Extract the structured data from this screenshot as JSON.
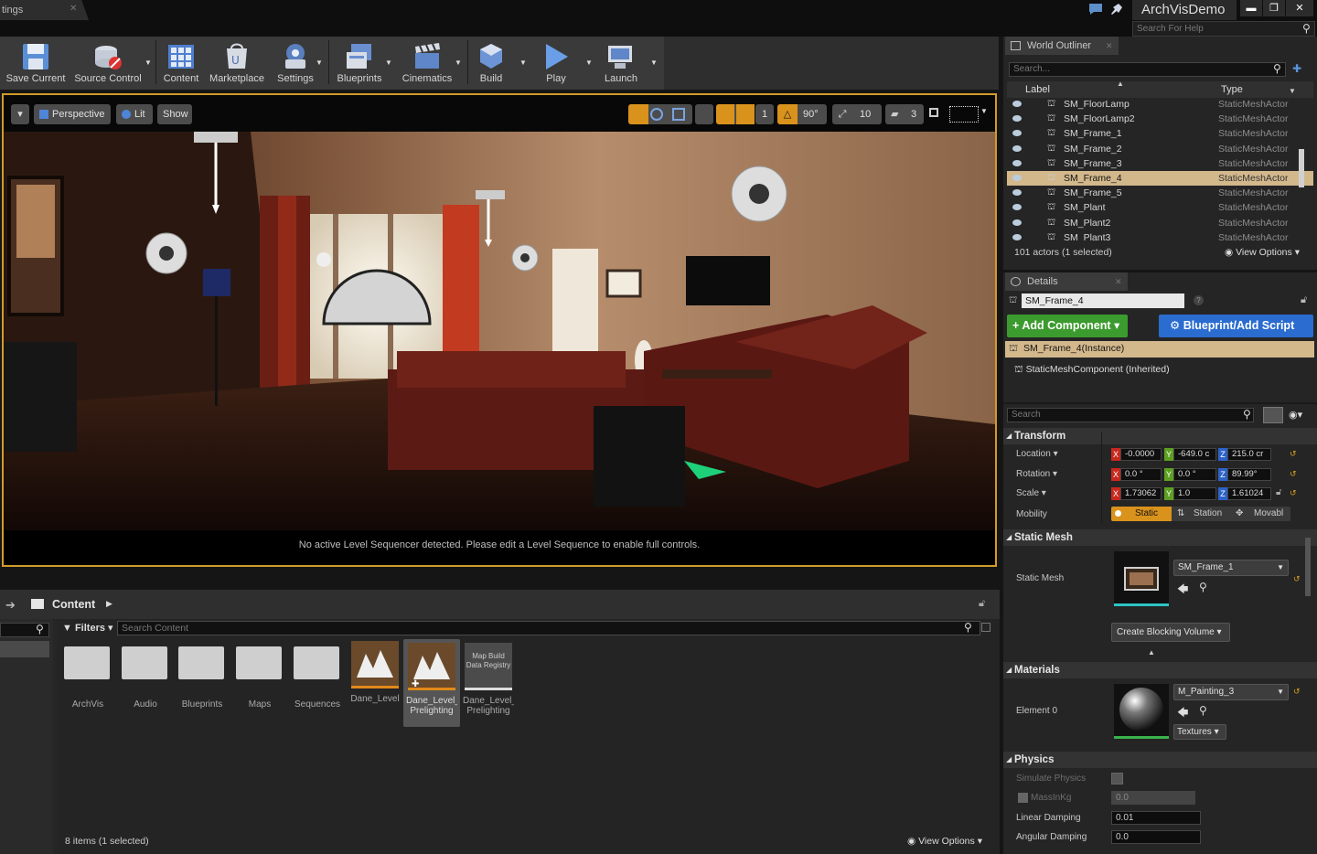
{
  "titlebar": {
    "tab_label": "tings",
    "project_name": "ArchVisDemo",
    "help_search_placeholder": "Search For Help"
  },
  "toolbar": {
    "buttons": [
      {
        "label": "Save Current"
      },
      {
        "label": "Source Control"
      },
      {
        "label": "Content"
      },
      {
        "label": "Marketplace"
      },
      {
        "label": "Settings"
      },
      {
        "label": "Blueprints"
      },
      {
        "label": "Cinematics"
      },
      {
        "label": "Build"
      },
      {
        "label": "Play"
      },
      {
        "label": "Launch"
      }
    ]
  },
  "viewport": {
    "view_mode": "Perspective",
    "lighting": "Lit",
    "show": "Show",
    "rotation_snap": "90°",
    "scale_snap": "10",
    "grid_snap": "1",
    "camera_speed": "3",
    "message": "No active Level Sequencer detected. Please edit a Level Sequence to enable full controls."
  },
  "content_browser": {
    "breadcrumb": "Content",
    "filters_label": "Filters",
    "search_placeholder": "Search Content",
    "status": "8 items (1 selected)",
    "view_options": "View Options",
    "assets": [
      {
        "label": "ArchVis",
        "kind": "folder"
      },
      {
        "label": "Audio",
        "kind": "folder"
      },
      {
        "label": "Blueprints",
        "kind": "folder"
      },
      {
        "label": "Maps",
        "kind": "folder"
      },
      {
        "label": "Sequences",
        "kind": "folder"
      },
      {
        "label": "Dane_Level",
        "kind": "level"
      },
      {
        "label": "Dane_Level_DemoMap Prelighting",
        "kind": "level"
      },
      {
        "label": "Dane_Level_DemoMap Prelighting",
        "kind": "registry",
        "thumb_text": "Map Build Data Registry"
      }
    ]
  },
  "outliner": {
    "title": "World Outliner",
    "search_placeholder": "Search...",
    "col_label": "Label",
    "col_type": "Type",
    "rows": [
      {
        "label": "SM_FloorLamp",
        "type": "StaticMeshActor"
      },
      {
        "label": "SM_FloorLamp2",
        "type": "StaticMeshActor"
      },
      {
        "label": "SM_Frame_1",
        "type": "StaticMeshActor"
      },
      {
        "label": "SM_Frame_2",
        "type": "StaticMeshActor"
      },
      {
        "label": "SM_Frame_3",
        "type": "StaticMeshActor"
      },
      {
        "label": "SM_Frame_4",
        "type": "StaticMeshActor",
        "selected": true
      },
      {
        "label": "SM_Frame_5",
        "type": "StaticMeshActor"
      },
      {
        "label": "SM_Plant",
        "type": "StaticMeshActor"
      },
      {
        "label": "SM_Plant2",
        "type": "StaticMeshActor"
      },
      {
        "label": "SM_Plant3",
        "type": "StaticMeshActor"
      }
    ],
    "status": "101 actors (1 selected)",
    "view_options": "View Options"
  },
  "details": {
    "title": "Details",
    "actor_name": "SM_Frame_4",
    "add_component": "Add Component",
    "blueprint_script": "Blueprint/Add Script",
    "instance_label": "SM_Frame_4(Instance)",
    "component_label": "StaticMeshComponent (Inherited)",
    "search_placeholder": "Search",
    "transform": {
      "title": "Transform",
      "location_label": "Location",
      "rotation_label": "Rotation",
      "scale_label": "Scale",
      "mobility_label": "Mobility",
      "location": {
        "x": "-0.0000",
        "y": "-649.0 c",
        "z": "215.0 cr"
      },
      "rotation": {
        "x": "0.0 °",
        "y": "0.0 °",
        "z": "89.99°"
      },
      "scale": {
        "x": "1.73062",
        "y": "1.0",
        "z": "1.61024"
      },
      "mobility": {
        "static": "Static",
        "stationary": "Station",
        "movable": "Movabl"
      }
    },
    "static_mesh": {
      "title": "Static Mesh",
      "label": "Static Mesh",
      "value": "SM_Frame_1",
      "blocking_volume": "Create Blocking Volume"
    },
    "materials": {
      "title": "Materials",
      "element_label": "Element 0",
      "value": "M_Painting_3",
      "textures": "Textures"
    },
    "physics": {
      "title": "Physics",
      "simulate_label": "Simulate Physics",
      "mass_label": "MassInKg",
      "mass_value": "0.0",
      "linear_label": "Linear Damping",
      "linear_value": "0.01",
      "angular_label": "Angular Damping",
      "angular_value": "0.0"
    }
  },
  "colors": {
    "accent": "#d19b2b",
    "add_component": "#3c9b2e",
    "blueprint": "#2a6ccf",
    "selection": "#d3b88c"
  }
}
